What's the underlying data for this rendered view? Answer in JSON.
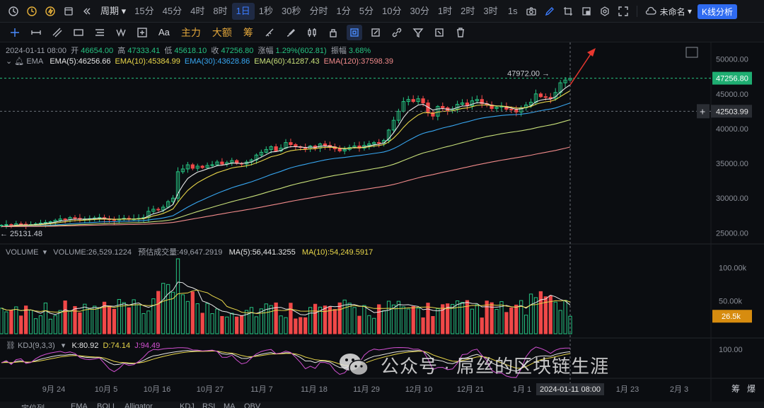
{
  "topbar": {
    "period_label": "周期",
    "timeframes": [
      "15分",
      "45分",
      "4时",
      "8时",
      "1日",
      "1秒",
      "30秒",
      "分时",
      "1分",
      "5分",
      "10分",
      "30分",
      "1时",
      "2时",
      "3时"
    ],
    "active_timeframe": "1日",
    "seconds_label": "1s",
    "layout_name": "未命名",
    "analysis_button": "K线分析"
  },
  "drawbar": {
    "main_force": "主力",
    "big_order": "大额",
    "chip": "筹",
    "text_tool": "Aa"
  },
  "ohlc": {
    "date": "2024-01-11 08:00",
    "open_label": "开",
    "open": "46654.00",
    "high_label": "高",
    "high": "47333.41",
    "low_label": "低",
    "low": "45618.10",
    "close_label": "收",
    "close": "47256.80",
    "change_label": "涨幅",
    "change": "1.29%(602.81)",
    "amp_label": "振幅",
    "amp": "3.68%"
  },
  "ema": {
    "label": "EMA",
    "items": [
      {
        "text": "EMA(5):46256.66",
        "color": "#e6e6e6"
      },
      {
        "text": "EMA(10):45384.99",
        "color": "#e8d64a"
      },
      {
        "text": "EMA(30):43628.86",
        "color": "#37a6f0"
      },
      {
        "text": "EMA(60):41287.43",
        "color": "#c8e07a"
      },
      {
        "text": "EMA(120):37598.39",
        "color": "#f08a8a"
      }
    ]
  },
  "price_axis": {
    "ticks": [
      "50000.00",
      "45000.00",
      "40000.00",
      "35000.00",
      "30000.00",
      "25000.00"
    ],
    "tick_values": [
      50000,
      45000,
      40000,
      35000,
      30000,
      25000
    ],
    "current_price": "47256.80",
    "crosshair_price": "42503.99",
    "high_marker": "47972.00",
    "low_marker": "25131.48"
  },
  "volume": {
    "label": "VOLUME",
    "value": "VOLUME:26,529.1224",
    "forecast": "预估成交量:49,647.2919",
    "ma5": "MA(5):56,441.3255",
    "ma10": "MA(10):54,249.5917",
    "ticks": [
      "100.00k",
      "50.00k"
    ],
    "current": "26.5k"
  },
  "kdj": {
    "label": "KDJ(9,3,3)",
    "k": "K:80.92",
    "d": "D:74.14",
    "j": "J:94.49",
    "tick": "100.00"
  },
  "x_axis": {
    "labels": [
      "9月 24",
      "10月 5",
      "10月 16",
      "10月 27",
      "11月 7",
      "11月 18",
      "11月 29",
      "12月 10",
      "12月 21",
      "1月 1",
      "1月 23",
      "2月 3"
    ],
    "crosshair_date": "2024-01-11 08:00",
    "right_labels": [
      "筹",
      "爆"
    ]
  },
  "bottom_tabs": [
    "定位列",
    "EMA",
    "BOLL",
    "Alligator",
    "KDJ",
    "RSI",
    "MA",
    "OBV"
  ],
  "watermark": "公众号 · 屌丝的区块链生涯",
  "colors": {
    "up": "#26c281",
    "down": "#f04848",
    "accent": "#2f6bf0",
    "current_price_bg": "#1fae72",
    "volume_tag_bg": "#d78c0f"
  },
  "chart_data": {
    "type": "candlestick",
    "ylim": [
      23000,
      52000
    ],
    "current_price": 47256.8,
    "crosshair_price": 42503.99,
    "high_marker": 47972.0,
    "low_marker": 25131.48,
    "dates_start": "9月 24",
    "candles_approx_close": [
      26100,
      26200,
      26050,
      26300,
      26250,
      26100,
      26200,
      26300,
      26400,
      26500,
      26600,
      26800,
      27000,
      26900,
      27200,
      27100,
      26950,
      27000,
      27050,
      27150,
      27200,
      27000,
      26900,
      26850,
      27000,
      27100,
      26950,
      27000,
      27100,
      27200,
      28100,
      28400,
      28300,
      28700,
      29500,
      30000,
      33800,
      34200,
      34800,
      34300,
      34600,
      34400,
      34700,
      34800,
      35200,
      34900,
      35100,
      35400,
      35000,
      34900,
      35200,
      35500,
      36200,
      36600,
      37000,
      37400,
      36800,
      37200,
      38000,
      37700,
      37400,
      37300,
      37100,
      37500,
      37200,
      37800,
      37600,
      37400,
      37100,
      36800,
      37000,
      37300,
      37500,
      37200,
      37600,
      37800,
      38000,
      37900,
      38300,
      39800,
      41200,
      42500,
      43900,
      44200,
      43900,
      44300,
      43700,
      42300,
      41800,
      43200,
      43000,
      42600,
      42800,
      43500,
      43700,
      43300,
      44000,
      44200,
      43600,
      43400,
      42900,
      43100,
      43200,
      42800,
      42700,
      42400,
      43000,
      43400,
      43800,
      45000,
      44600,
      44500,
      44300,
      45200,
      46600,
      47000,
      47256
    ]
  }
}
